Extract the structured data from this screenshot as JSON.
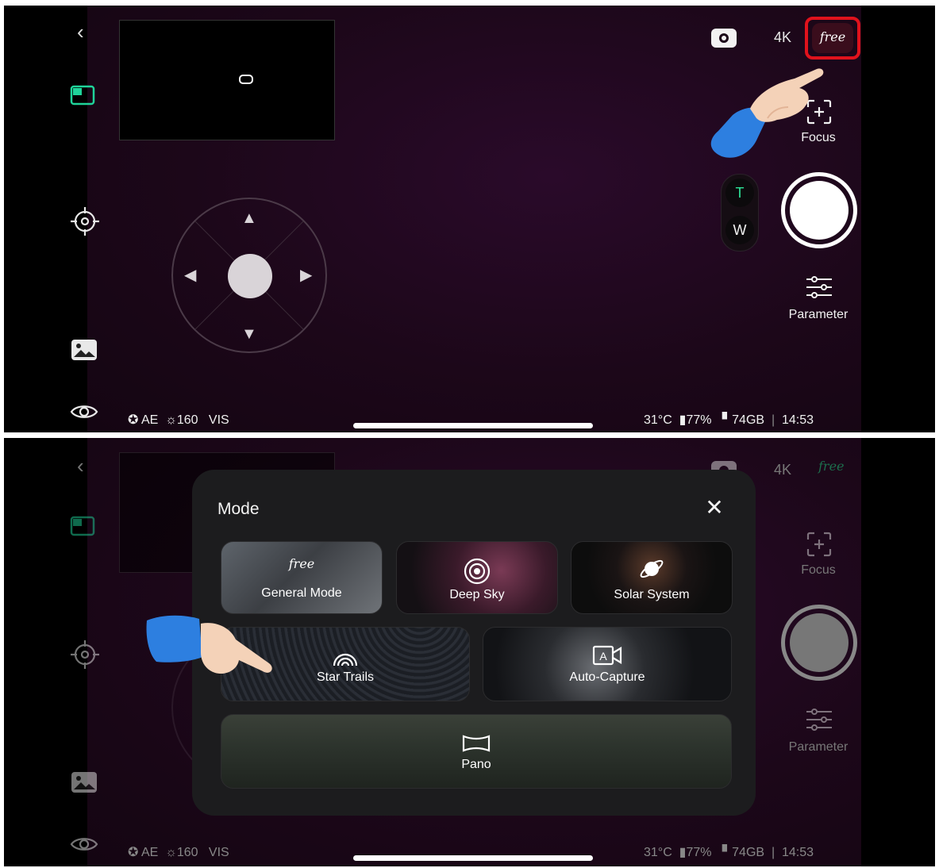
{
  "camera": {
    "back_glyph": "‹",
    "resolution": "4K",
    "free_badge": "free",
    "focus_label": "Focus",
    "tele_label": "T",
    "wide_label": "W",
    "parameter_label": "Parameter",
    "icons": [
      "chevron-left-icon",
      "layout-icon",
      "target-icon",
      "gallery-icon",
      "eye-icon",
      "camera-icon",
      "focus-icon",
      "sliders-icon"
    ]
  },
  "status_bar": {
    "ae": "AE",
    "brightness": "160",
    "vis": "VIS",
    "temperature": "31°C",
    "battery": "77%",
    "storage": "74GB",
    "separator": "|",
    "time": "14:53"
  },
  "mode_dialog": {
    "title": "Mode",
    "close_glyph": "✕",
    "modes": [
      {
        "label": "General Mode",
        "badge": "free",
        "icon": "free-icon"
      },
      {
        "label": "Deep Sky",
        "icon": "galaxy-icon"
      },
      {
        "label": "Solar System",
        "icon": "planet-icon"
      },
      {
        "label": "Star Trails",
        "icon": "star-trails-icon"
      },
      {
        "label": "Auto-Capture",
        "icon": "auto-capture-icon"
      },
      {
        "label": "Pano",
        "icon": "panorama-icon"
      }
    ]
  },
  "colors": {
    "highlight": "#e0121c",
    "accent_green": "#1fd39a",
    "tele_green": "#2ee59a"
  }
}
